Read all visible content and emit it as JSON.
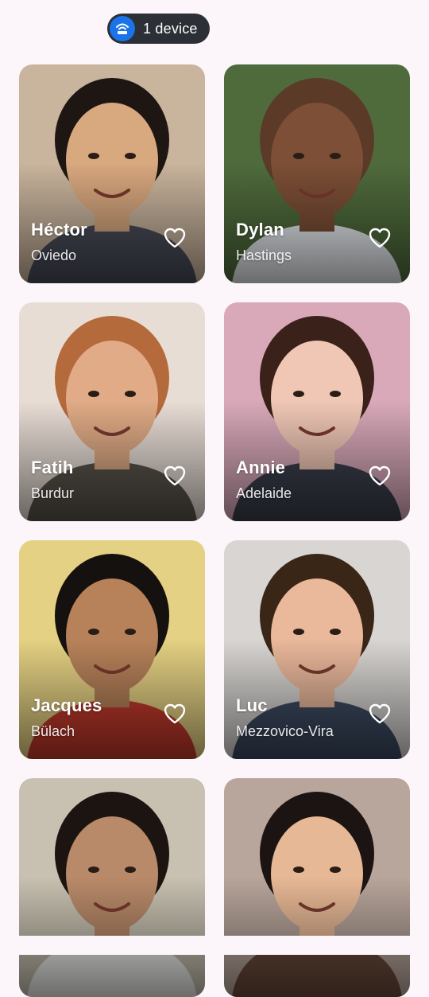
{
  "status_bar": {
    "device_pill_label": "1 device",
    "accent_color": "#1a73e8",
    "pill_color": "#2c2f36"
  },
  "profiles": [
    {
      "name": "Héctor",
      "city": "Oviedo",
      "photo_bg": "#c9b49d",
      "skin": "#d8a87f",
      "hair": "#1e1612",
      "shirt": "#4a4d5a"
    },
    {
      "name": "Dylan",
      "city": "Hastings",
      "photo_bg": "#4f6b3c",
      "skin": "#7c4f36",
      "hair": "#5b3a28",
      "shirt": "#e9edf1"
    },
    {
      "name": "Fatih",
      "city": "Burdur",
      "photo_bg": "#e8ddd5",
      "skin": "#e0ab86",
      "hair": "#b56a3c",
      "shirt": "#5a544c"
    },
    {
      "name": "Annie",
      "city": "Adelaide",
      "photo_bg": "#d9a9b9",
      "skin": "#f0c7b5",
      "hair": "#3a2119",
      "shirt": "#3b3f4c"
    },
    {
      "name": "Jacques",
      "city": "Bülach",
      "photo_bg": "#e5d183",
      "skin": "#b7825a",
      "hair": "#15110e",
      "shirt": "#c53a2c"
    },
    {
      "name": "Luc",
      "city": "Mezzovico-Vira",
      "photo_bg": "#d8d5d2",
      "skin": "#eab89b",
      "hair": "#3a2617",
      "shirt": "#3d4b62"
    },
    {
      "name": "",
      "city": "",
      "photo_bg": "#c8c1b1",
      "skin": "#b98a69",
      "hair": "#1b1410",
      "shirt": "#f0f0ee"
    },
    {
      "name": "",
      "city": "",
      "photo_bg": "#b8a59b",
      "skin": "#e7b895",
      "hair": "#1c1412",
      "shirt": "#6b4a3b"
    }
  ],
  "icons": {
    "device_icon": "wifi-router-icon",
    "favorite_icon": "heart-outline-icon"
  }
}
